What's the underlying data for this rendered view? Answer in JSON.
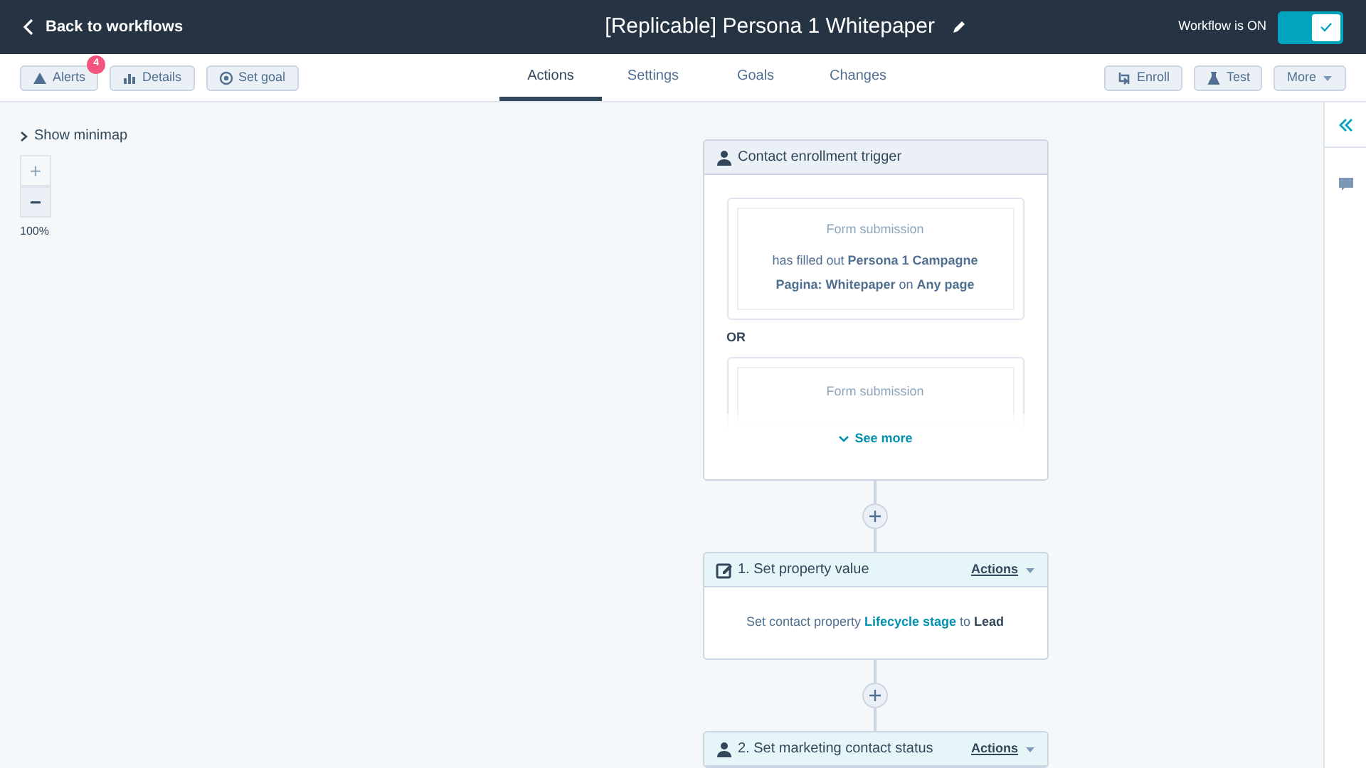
{
  "header": {
    "back": "Back to workflows",
    "title": "[Replicable] Persona 1 Whitepaper",
    "status_label": "Workflow is ON",
    "on": true
  },
  "toolbar_left": [
    {
      "label": "Alerts",
      "kind": "alert",
      "badge": "4"
    },
    {
      "label": "Details",
      "kind": "chart"
    },
    {
      "label": "Set goal",
      "kind": "target"
    }
  ],
  "tabs": [
    {
      "label": "Actions",
      "selected": true
    },
    {
      "label": "Settings",
      "selected": false
    },
    {
      "label": "Goals",
      "selected": false
    },
    {
      "label": "Changes",
      "selected": false
    }
  ],
  "toolbar_right": [
    {
      "label": "Enroll",
      "kind": "enroll"
    },
    {
      "label": "Test",
      "kind": "test"
    },
    {
      "label": "More",
      "kind": "more"
    }
  ],
  "minimap": {
    "label": "Show minimap",
    "expanded": false
  },
  "zoom_controls": [
    {
      "label": "+",
      "disabled": true
    },
    {
      "label": "−",
      "disabled": false
    }
  ],
  "zoom_level": "100%",
  "trigger": {
    "title": "Contact enrollment trigger",
    "conditions": [
      {
        "type": "Form submission",
        "text": "has filled out **Persona 1 Campagne Pagina: Whitepaper** on **Any page**"
      },
      {
        "type": "Form submission"
      }
    ],
    "separator": "OR",
    "see_more": "See more"
  },
  "actions": [
    {
      "kind": "edit",
      "title": "1. Set property value",
      "menu": "Actions",
      "body": [
        {
          "kind": "plain",
          "text": "Set contact property "
        },
        {
          "kind": "link",
          "text": "Lifecycle stage"
        },
        {
          "kind": "plain",
          "text": " to "
        },
        {
          "kind": "bold",
          "text": "Lead"
        }
      ]
    },
    {
      "kind": "person",
      "title": "2. Set marketing contact status",
      "menu": "Actions"
    }
  ]
}
